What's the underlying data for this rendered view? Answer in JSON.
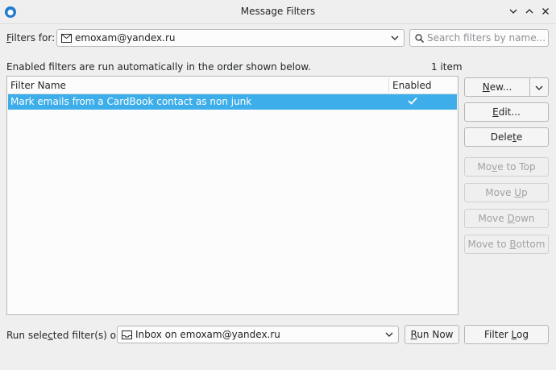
{
  "window": {
    "title": "Message Filters",
    "controls": [
      "minimize",
      "maximize",
      "close"
    ]
  },
  "filters_for": {
    "label_before": "F",
    "label_after": "ilters for:",
    "account": "emoxam@yandex.ru"
  },
  "search": {
    "placeholder": "Search filters by name..."
  },
  "info": {
    "description": "Enabled filters are run automatically in the order shown below.",
    "count": "1 item"
  },
  "list": {
    "columns": [
      "Filter Name",
      "Enabled"
    ],
    "rows": [
      {
        "name": "Mark emails from a CardBook contact as non junk",
        "enabled": true,
        "selected": true
      }
    ]
  },
  "buttons": {
    "new": {
      "a": "N",
      "b": "ew..."
    },
    "edit": {
      "a": "E",
      "b": "dit..."
    },
    "delete": {
      "a": "Dele",
      "b": "t",
      "c": "e"
    },
    "move_top": {
      "a": "Mo",
      "b": "v",
      "c": "e to Top"
    },
    "move_up": {
      "a": "Move ",
      "b": "U",
      "c": "p"
    },
    "move_down": {
      "a": "Move ",
      "b": "D",
      "c": "own"
    },
    "move_bottom": {
      "a": "Move to ",
      "b": "B",
      "c": "ottom"
    }
  },
  "run": {
    "label_a": "Run sele",
    "label_b": "c",
    "label_c": "ted filter(s) on:",
    "folder": "Inbox on emoxam@yandex.ru",
    "run_now": {
      "a": "",
      "b": "R",
      "c": "un Now"
    },
    "filter_log": {
      "a": "Filter ",
      "b": "L",
      "c": "og"
    }
  }
}
